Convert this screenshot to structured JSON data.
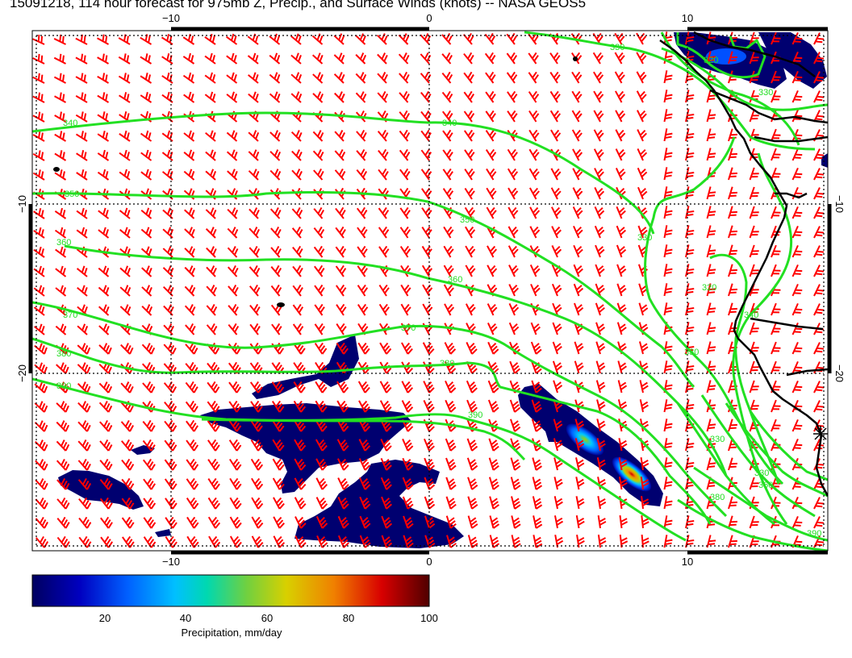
{
  "title": "15091218, 114 hour forecast for 975mb Z, Precip., and Surface Winds (knots) -- NASA GEOS5",
  "axes": {
    "top": [
      "−10",
      "0",
      "10"
    ],
    "bottom": [
      "−10",
      "0",
      "10"
    ],
    "left": [
      "−10",
      "−20"
    ],
    "right": [
      "−10",
      "−20"
    ]
  },
  "colorbar": {
    "ticks": [
      "20",
      "40",
      "60",
      "80",
      "100"
    ],
    "label": "Precipitation, mm/day",
    "colors": [
      "#000080",
      "#0000e0",
      "#0070ff",
      "#00c8ff",
      "#00d8a0",
      "#70d040",
      "#d8d000",
      "#f08000",
      "#d80000",
      "#600000"
    ]
  },
  "contours": [
    {
      "label": "330"
    },
    {
      "label": "320"
    },
    {
      "label": "330"
    },
    {
      "label": "340"
    },
    {
      "label": "340"
    },
    {
      "label": "350"
    },
    {
      "label": "350"
    },
    {
      "label": "330"
    },
    {
      "label": "320"
    },
    {
      "label": "360"
    },
    {
      "label": "360"
    },
    {
      "label": "330"
    },
    {
      "label": "370"
    },
    {
      "label": "370"
    },
    {
      "label": "340"
    },
    {
      "label": "380"
    },
    {
      "label": "380"
    },
    {
      "label": "390"
    },
    {
      "label": "390"
    },
    {
      "label": "330"
    },
    {
      "label": "330"
    },
    {
      "label": "360"
    },
    {
      "label": "380"
    },
    {
      "label": "390"
    }
  ],
  "colors": {
    "contour": "#22e022",
    "wind": "#ff0000",
    "coast": "#000000"
  }
}
